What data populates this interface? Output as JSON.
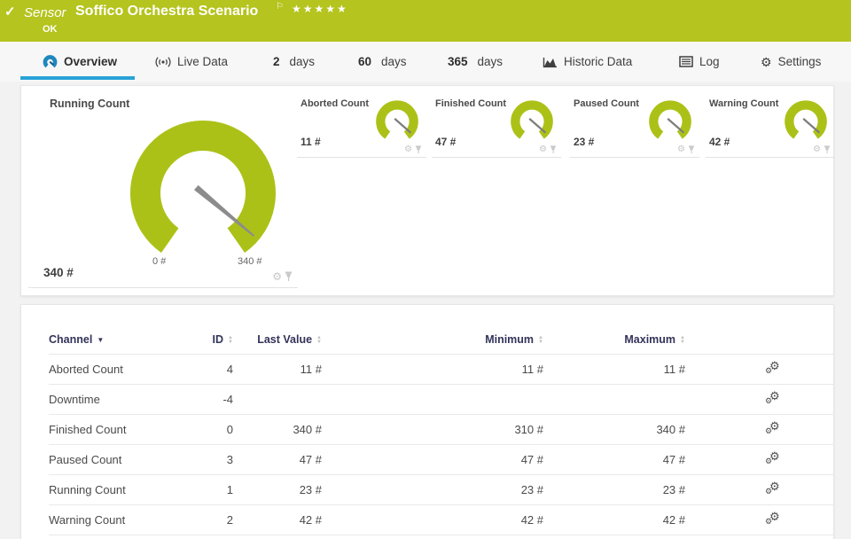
{
  "header": {
    "kind_label": "Sensor",
    "title": "Soffico Orchestra Scenario",
    "status": "OK",
    "priority_stars": "★★★★★",
    "color": "#b5c41e"
  },
  "icons": {
    "check": "✓",
    "flag": "⚐",
    "gear": "⚙",
    "caret_up": "▲",
    "caret_down": "▼"
  },
  "tabs": {
    "items": [
      {
        "label": "Overview",
        "icon": "gauge-icon",
        "active": true
      },
      {
        "label": "Live Data",
        "icon": "live-data-icon"
      },
      {
        "num": "2",
        "unit": "days"
      },
      {
        "num": "60",
        "unit": "days"
      },
      {
        "num": "365",
        "unit": "days"
      },
      {
        "label": "Historic Data",
        "icon": "historic-data-icon"
      },
      {
        "label": "Log",
        "icon": "log-icon"
      },
      {
        "label": "Settings",
        "icon": "gear-icon"
      }
    ]
  },
  "gauges": {
    "gauge_color": "#acc117",
    "needle_color": "#8c8c8c",
    "main": {
      "label": "Running Count",
      "value": "340 #",
      "scale_min": "0 #",
      "scale_max": "340 #"
    },
    "small": [
      {
        "label": "Aborted Count",
        "value": "11 #"
      },
      {
        "label": "Finished Count",
        "value": "47 #"
      },
      {
        "label": "Paused Count",
        "value": "23 #"
      },
      {
        "label": "Warning Count",
        "value": "42 #"
      }
    ]
  },
  "table": {
    "columns": {
      "channel": "Channel",
      "id": "ID",
      "last": "Last Value",
      "min": "Minimum",
      "max": "Maximum"
    },
    "rows": [
      {
        "channel": "Aborted Count",
        "id": "4",
        "last": "11 #",
        "min": "11 #",
        "max": "11 #"
      },
      {
        "channel": "Downtime",
        "id": "-4",
        "last": "",
        "min": "",
        "max": ""
      },
      {
        "channel": "Finished Count",
        "id": "0",
        "last": "340 #",
        "min": "310 #",
        "max": "340 #"
      },
      {
        "channel": "Paused Count",
        "id": "3",
        "last": "47 #",
        "min": "47 #",
        "max": "47 #"
      },
      {
        "channel": "Running Count",
        "id": "1",
        "last": "23 #",
        "min": "23 #",
        "max": "23 #"
      },
      {
        "channel": "Warning Count",
        "id": "2",
        "last": "42 #",
        "min": "42 #",
        "max": "42 #"
      }
    ]
  }
}
